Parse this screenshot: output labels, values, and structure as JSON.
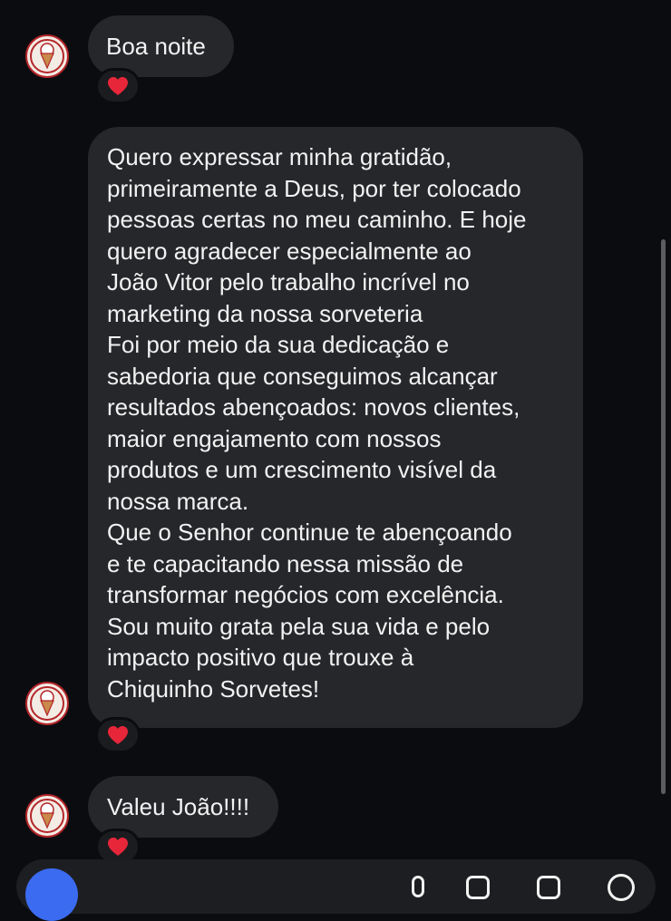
{
  "messages": [
    {
      "id": "m1",
      "lines": [
        "Boa noite"
      ],
      "reaction": "heart"
    },
    {
      "id": "m2",
      "lines": [
        "Quero expressar minha gratidão,",
        "primeiramente a Deus, por ter colocado",
        "pessoas certas no meu caminho. E hoje",
        "quero agradecer especialmente ao",
        "João Vitor pelo trabalho incrível no",
        "marketing da nossa sorveteria",
        "Foi por meio da sua dedicação e",
        "sabedoria que conseguimos alcançar",
        "resultados abençoados: novos clientes,",
        "maior engajamento com nossos",
        "produtos e um crescimento visível da",
        "nossa marca.",
        "Que o Senhor continue te abençoando",
        "e te capacitando nessa missão de",
        "transformar negócios com excelência.",
        "Sou muito grata pela sua vida e pelo",
        "impacto positivo que trouxe à",
        "Chiquinho Sorvetes!"
      ],
      "reaction": "heart"
    },
    {
      "id": "m3",
      "lines": [
        "Valeu João!!!!"
      ],
      "reaction": "heart"
    }
  ],
  "avatar": {
    "icon": "ice-cream-logo-icon",
    "ring_color": "#b4262a"
  },
  "reaction_icon": "heart-icon",
  "colors": {
    "background": "#0b0c10",
    "bubble": "#26272b",
    "text": "#f2f2f2",
    "heart": "#e8263a",
    "accent": "#3b6bf0"
  }
}
